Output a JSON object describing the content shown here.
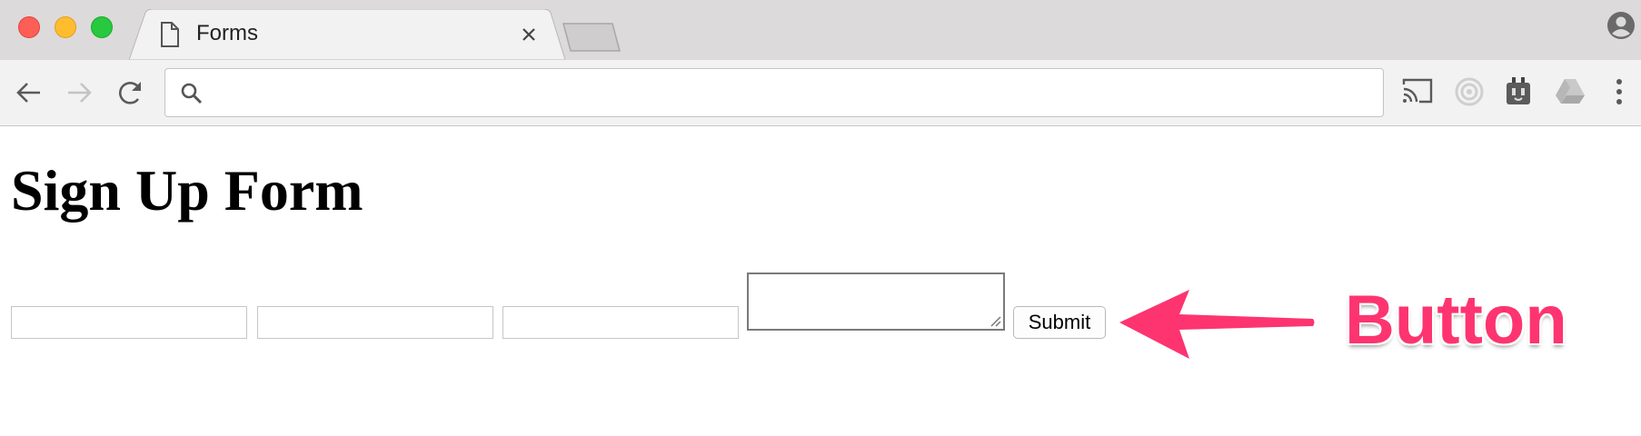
{
  "browser": {
    "tab": {
      "title": "Forms",
      "icon": "document-icon"
    },
    "omnibox": {
      "value": "",
      "placeholder": ""
    },
    "extensions": [
      "cast-icon",
      "extension-target-icon",
      "extension-plug-icon",
      "drive-icon",
      "more-vert-icon"
    ]
  },
  "page": {
    "heading": "Sign Up Form",
    "fields": [
      {
        "value": ""
      },
      {
        "value": ""
      },
      {
        "value": ""
      }
    ],
    "textarea": {
      "value": ""
    },
    "submit_label": "Submit"
  },
  "annotation": {
    "label": "Button",
    "color": "#fd3470"
  }
}
